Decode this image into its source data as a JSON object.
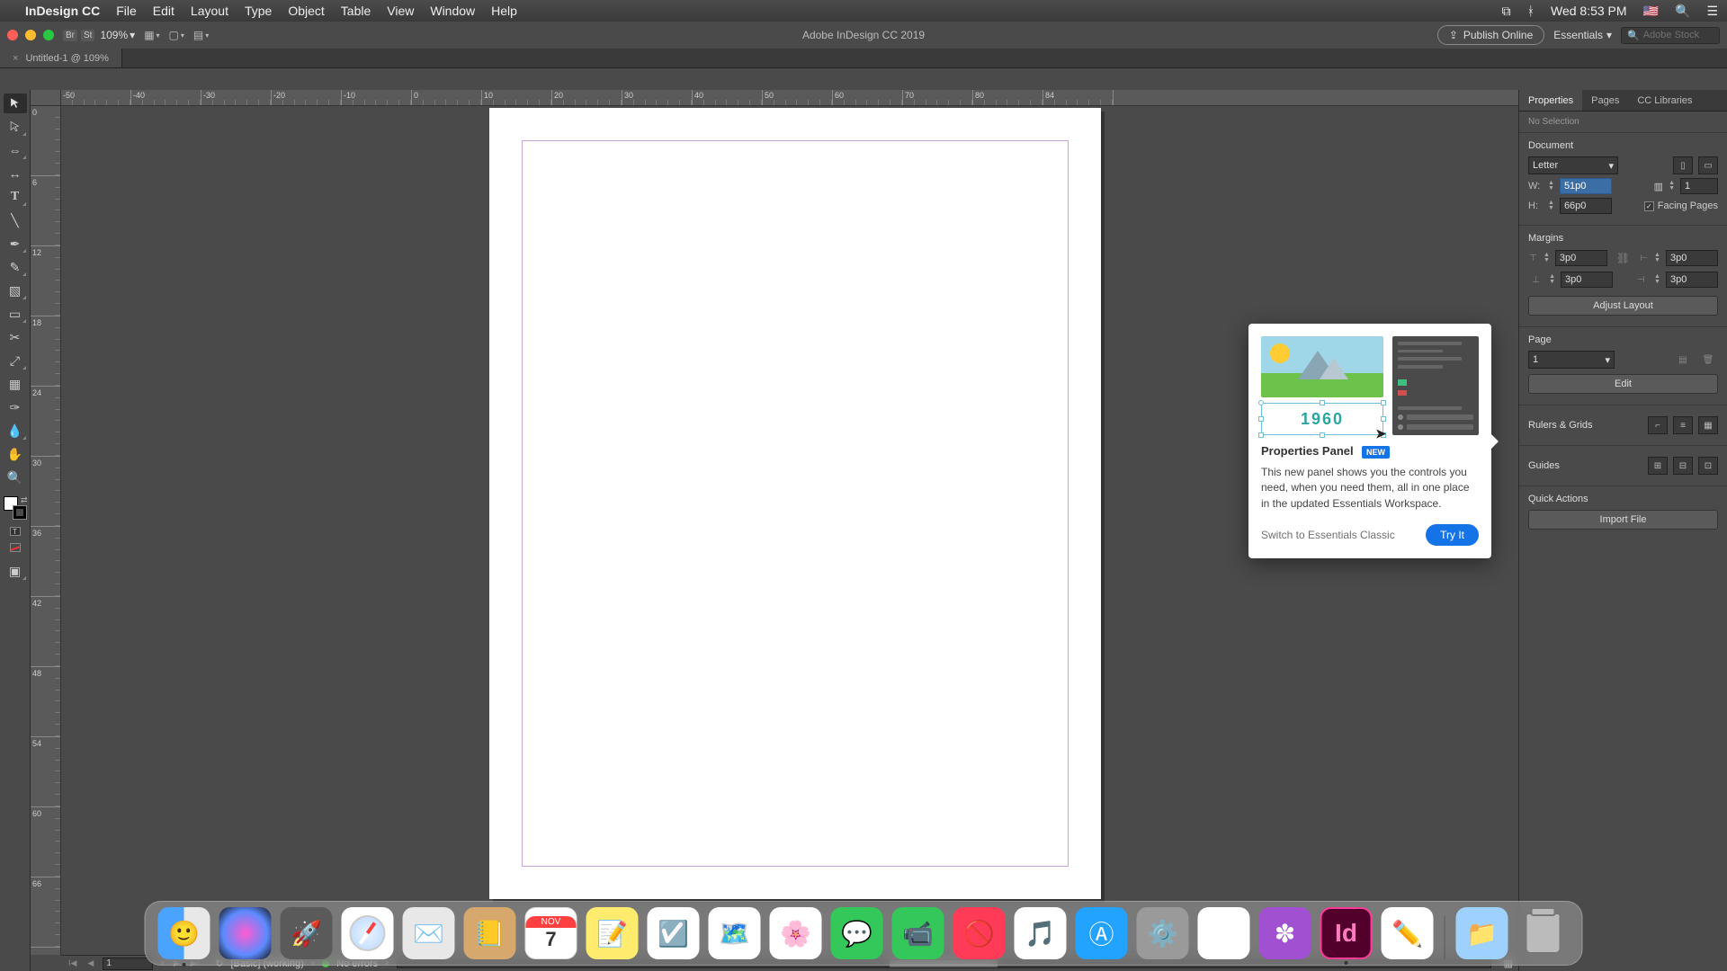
{
  "mac_menu": {
    "app_name": "InDesign CC",
    "items": [
      "File",
      "Edit",
      "Layout",
      "Type",
      "Object",
      "Table",
      "View",
      "Window",
      "Help"
    ],
    "right": {
      "datetime": "Wed 8:53 PM"
    }
  },
  "titlebar": {
    "badges": [
      "Br",
      "St"
    ],
    "zoom": "109%",
    "title": "Adobe InDesign CC 2019",
    "publish_online": "Publish Online",
    "workspace": "Essentials",
    "stock_placeholder": "Adobe Stock"
  },
  "doc": {
    "tab_label": "Untitled-1 @ 109%"
  },
  "ruler": {
    "h_values": [
      "-50",
      "-40",
      "-30",
      "-20",
      "-10",
      "0",
      "10",
      "20",
      "30",
      "40",
      "50",
      "60",
      "70",
      "80",
      "84"
    ],
    "v_values": [
      "0",
      "6",
      "12",
      "18",
      "24",
      "30",
      "36",
      "42",
      "48",
      "54",
      "60",
      "66"
    ]
  },
  "status": {
    "page": "1",
    "profile": "[Basic] (working)",
    "errors": "No errors"
  },
  "right_panel": {
    "tabs": [
      "Properties",
      "Pages",
      "CC Libraries"
    ],
    "active_tab": "Properties",
    "selection": "No Selection",
    "sections": {
      "document": {
        "title": "Document",
        "preset": "Letter",
        "w_label": "W:",
        "w_value": "51p0",
        "h_label": "H:",
        "h_value": "66p0",
        "facing_label": "Facing Pages",
        "facing_checked": true
      },
      "margins": {
        "title": "Margins",
        "top": "3p0",
        "bottom": "3p0",
        "left": "3p0",
        "right": "3p0",
        "adjust_layout": "Adjust Layout"
      },
      "page": {
        "title": "Page",
        "value": "1",
        "edit": "Edit"
      },
      "rulers": {
        "title": "Rulers & Grids"
      },
      "guides": {
        "title": "Guides"
      },
      "quick": {
        "title": "Quick Actions",
        "import": "Import File"
      }
    }
  },
  "popover": {
    "title": "Properties Panel",
    "badge": "NEW",
    "illus_year": "1960",
    "body": "This new panel shows you the controls you need, when you need them, all in one place in the updated Essentials Workspace.",
    "switch": "Switch to Essentials Classic",
    "try": "Try It"
  },
  "dock": {
    "cal_month": "NOV",
    "cal_day": "7"
  }
}
